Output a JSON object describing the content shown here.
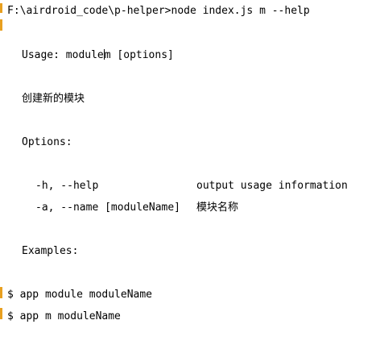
{
  "prompt": {
    "path": "F:\\airdroid_code\\p-helper>",
    "command": "node index.js m --help"
  },
  "usage": {
    "label": "Usage: ",
    "command_before_cursor": "module",
    "command_after_cursor": "m [options]"
  },
  "description": "创建新的模块",
  "options": {
    "heading": "Options:",
    "items": [
      {
        "flags": "-h, --help",
        "description": "output usage information"
      },
      {
        "flags": "-a, --name [moduleName]",
        "description": "模块名称"
      }
    ]
  },
  "examples": {
    "heading": "Examples:",
    "items": [
      "$ app module moduleName",
      "$ app m moduleName"
    ]
  },
  "colors": {
    "background": "#ffffff",
    "text": "#000000",
    "gutter_marker": "#e8a020"
  }
}
